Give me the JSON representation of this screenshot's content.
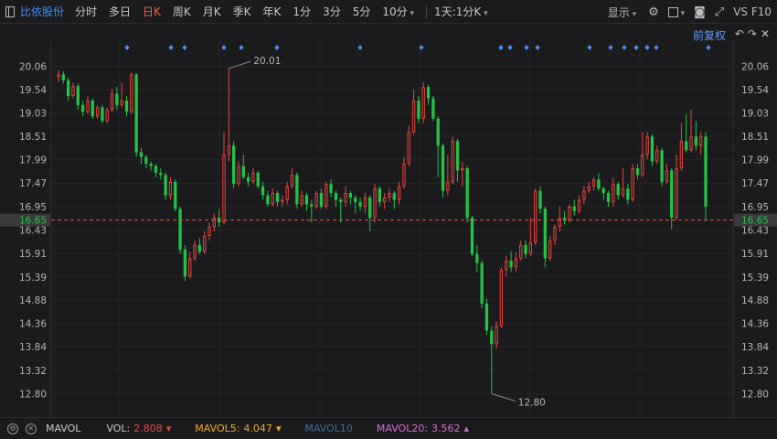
{
  "toolbar": {
    "stock_name": "比依股份",
    "periods": [
      "分时",
      "多日",
      "日K",
      "周K",
      "月K",
      "季K",
      "年K",
      "1分",
      "3分",
      "5分",
      "10分"
    ],
    "active_period": "日K",
    "combo": "1天:1分K",
    "display": "显示",
    "right_text": "VS F10"
  },
  "fuquan": "前复权",
  "icons": {
    "settings": "gear-icon",
    "window": "window-icon",
    "camera": "camera-icon",
    "expand": "expand-icon",
    "undo": "undo-icon",
    "redo": "redo-icon",
    "close": "close-icon"
  },
  "chart_data": {
    "type": "candlestick",
    "y_ticks": [
      "20.06",
      "19.54",
      "19.03",
      "18.51",
      "17.99",
      "17.47",
      "16.95",
      "16.43",
      "15.91",
      "15.39",
      "14.88",
      "14.36",
      "13.84",
      "13.32",
      "12.80"
    ],
    "ylim": [
      12.8,
      20.06
    ],
    "current_price": "16.65",
    "high_label": "20.01",
    "low_label": "12.80",
    "high": 20.01,
    "low": 12.8,
    "up_color": "#e8453c",
    "down_color": "#23c343",
    "candles": [
      [
        19.82,
        19.88,
        19.98,
        19.72
      ],
      [
        19.88,
        19.75,
        19.95,
        19.68
      ],
      [
        19.75,
        19.4,
        19.8,
        19.3
      ],
      [
        19.4,
        19.62,
        19.7,
        19.35
      ],
      [
        19.62,
        19.2,
        19.68,
        19.1
      ],
      [
        19.2,
        19.05,
        19.3,
        18.95
      ],
      [
        19.05,
        19.3,
        19.4,
        19.0
      ],
      [
        19.3,
        18.95,
        19.35,
        18.9
      ],
      [
        18.95,
        19.15,
        19.2,
        18.9
      ],
      [
        19.15,
        18.85,
        19.2,
        18.8
      ],
      [
        18.85,
        19.1,
        19.15,
        18.8
      ],
      [
        19.1,
        19.45,
        19.55,
        19.05
      ],
      [
        19.45,
        19.2,
        19.6,
        19.1
      ],
      [
        19.2,
        19.3,
        19.7,
        19.15
      ],
      [
        19.3,
        19.05,
        19.4,
        18.95
      ],
      [
        19.05,
        19.88,
        19.92,
        19.0
      ],
      [
        19.88,
        18.15,
        19.9,
        18.05
      ],
      [
        18.15,
        18.05,
        18.25,
        17.9
      ],
      [
        18.05,
        17.9,
        18.1,
        17.8
      ],
      [
        17.9,
        17.85,
        17.95,
        17.75
      ],
      [
        17.85,
        17.7,
        17.9,
        17.6
      ],
      [
        17.7,
        17.65,
        17.8,
        17.55
      ],
      [
        17.65,
        17.2,
        17.7,
        17.1
      ],
      [
        17.2,
        17.5,
        17.6,
        17.1
      ],
      [
        17.5,
        16.9,
        17.55,
        16.85
      ],
      [
        16.9,
        16.0,
        16.95,
        15.9
      ],
      [
        16.0,
        15.4,
        16.1,
        15.3
      ],
      [
        15.4,
        15.8,
        15.95,
        15.35
      ],
      [
        15.8,
        16.1,
        16.2,
        15.75
      ],
      [
        16.1,
        15.95,
        16.25,
        15.9
      ],
      [
        15.95,
        16.3,
        16.4,
        15.9
      ],
      [
        16.3,
        16.5,
        16.6,
        16.2
      ],
      [
        16.5,
        16.7,
        16.8,
        16.4
      ],
      [
        16.7,
        16.6,
        16.9,
        16.5
      ],
      [
        16.6,
        18.1,
        18.6,
        16.55
      ],
      [
        18.1,
        18.3,
        20.01,
        17.95
      ],
      [
        18.3,
        17.45,
        18.4,
        17.35
      ],
      [
        17.45,
        17.85,
        17.95,
        17.4
      ],
      [
        17.85,
        17.6,
        18.1,
        17.55
      ],
      [
        17.6,
        17.5,
        17.7,
        17.4
      ],
      [
        17.5,
        17.7,
        17.8,
        17.45
      ],
      [
        17.7,
        17.4,
        17.75,
        17.35
      ],
      [
        17.4,
        17.2,
        17.5,
        17.1
      ],
      [
        17.2,
        17.0,
        17.3,
        16.95
      ],
      [
        17.0,
        17.25,
        17.35,
        16.95
      ],
      [
        17.25,
        17.05,
        17.3,
        16.95
      ],
      [
        17.05,
        17.1,
        17.2,
        16.95
      ],
      [
        17.1,
        17.4,
        17.5,
        17.0
      ],
      [
        17.4,
        17.65,
        17.8,
        17.35
      ],
      [
        17.65,
        17.0,
        17.7,
        16.9
      ],
      [
        17.0,
        17.2,
        17.3,
        16.95
      ],
      [
        17.2,
        17.0,
        17.25,
        16.85
      ],
      [
        17.0,
        16.95,
        17.1,
        16.6
      ],
      [
        16.95,
        17.25,
        17.3,
        16.9
      ],
      [
        17.25,
        16.95,
        17.35,
        16.9
      ],
      [
        16.95,
        17.45,
        17.5,
        16.9
      ],
      [
        17.45,
        17.25,
        17.55,
        17.15
      ],
      [
        17.25,
        17.1,
        17.3,
        16.95
      ],
      [
        17.1,
        17.05,
        17.15,
        16.6
      ],
      [
        17.05,
        17.25,
        17.4,
        16.95
      ],
      [
        17.25,
        17.15,
        17.3,
        17.0
      ],
      [
        17.15,
        17.05,
        17.2,
        16.8
      ],
      [
        17.05,
        16.95,
        17.15,
        16.85
      ],
      [
        16.95,
        17.15,
        17.25,
        16.8
      ],
      [
        17.15,
        16.7,
        17.2,
        16.4
      ],
      [
        16.7,
        17.35,
        17.45,
        16.6
      ],
      [
        17.35,
        17.05,
        17.4,
        16.95
      ],
      [
        17.05,
        17.15,
        17.25,
        16.9
      ],
      [
        17.15,
        17.25,
        17.35,
        17.05
      ],
      [
        17.25,
        17.1,
        17.3,
        16.9
      ],
      [
        17.1,
        17.4,
        17.5,
        17.0
      ],
      [
        17.4,
        17.9,
        18.05,
        17.35
      ],
      [
        17.9,
        18.6,
        18.75,
        17.85
      ],
      [
        18.6,
        19.3,
        19.55,
        18.55
      ],
      [
        19.3,
        18.9,
        19.4,
        18.8
      ],
      [
        18.9,
        19.6,
        19.7,
        18.8
      ],
      [
        19.6,
        19.35,
        19.65,
        19.2
      ],
      [
        19.35,
        18.9,
        19.4,
        18.85
      ],
      [
        18.9,
        18.3,
        18.95,
        17.6
      ],
      [
        18.3,
        17.3,
        18.35,
        17.15
      ],
      [
        17.3,
        17.5,
        18.1,
        17.2
      ],
      [
        17.5,
        18.4,
        18.5,
        17.45
      ],
      [
        18.4,
        17.75,
        18.45,
        17.5
      ],
      [
        17.75,
        17.8,
        17.95,
        17.4
      ],
      [
        17.8,
        16.7,
        17.85,
        16.6
      ],
      [
        16.7,
        15.9,
        16.75,
        15.85
      ],
      [
        15.9,
        15.7,
        16.1,
        15.5
      ],
      [
        15.7,
        14.8,
        15.75,
        14.7
      ],
      [
        14.8,
        14.2,
        14.9,
        14.1
      ],
      [
        14.2,
        13.9,
        14.3,
        12.8
      ],
      [
        13.9,
        14.3,
        14.4,
        13.8
      ],
      [
        14.3,
        15.55,
        15.6,
        14.25
      ],
      [
        15.55,
        15.75,
        15.85,
        15.4
      ],
      [
        15.75,
        15.6,
        15.95,
        15.5
      ],
      [
        15.6,
        15.8,
        15.95,
        15.5
      ],
      [
        15.8,
        16.1,
        16.2,
        15.75
      ],
      [
        16.1,
        15.9,
        16.2,
        15.8
      ],
      [
        15.9,
        16.15,
        16.7,
        15.85
      ],
      [
        16.15,
        17.3,
        17.35,
        16.1
      ],
      [
        17.3,
        16.9,
        17.4,
        16.8
      ],
      [
        16.9,
        15.8,
        16.95,
        15.6
      ],
      [
        15.8,
        16.2,
        16.3,
        15.75
      ],
      [
        16.2,
        16.5,
        16.55,
        16.1
      ],
      [
        16.5,
        16.7,
        16.95,
        16.4
      ],
      [
        16.7,
        16.65,
        16.85,
        16.55
      ],
      [
        16.65,
        16.95,
        17.0,
        16.6
      ],
      [
        16.95,
        16.85,
        17.1,
        16.75
      ],
      [
        16.85,
        17.1,
        17.2,
        16.8
      ],
      [
        17.1,
        17.3,
        17.4,
        17.0
      ],
      [
        17.3,
        17.4,
        17.5,
        17.25
      ],
      [
        17.4,
        17.55,
        17.6,
        17.3
      ],
      [
        17.55,
        17.35,
        17.7,
        17.3
      ],
      [
        17.35,
        17.25,
        17.4,
        17.1
      ],
      [
        17.25,
        17.05,
        17.3,
        16.95
      ],
      [
        17.05,
        17.45,
        17.6,
        16.95
      ],
      [
        17.45,
        17.2,
        17.5,
        17.1
      ],
      [
        17.2,
        17.35,
        17.8,
        17.15
      ],
      [
        17.35,
        17.1,
        17.45,
        17.0
      ],
      [
        17.1,
        17.8,
        17.9,
        17.05
      ],
      [
        17.8,
        17.65,
        17.9,
        17.55
      ],
      [
        17.65,
        18.1,
        18.6,
        17.6
      ],
      [
        18.1,
        18.5,
        18.6,
        18.0
      ],
      [
        18.5,
        17.95,
        18.55,
        17.85
      ],
      [
        17.95,
        18.2,
        18.3,
        17.9
      ],
      [
        18.2,
        17.5,
        18.25,
        17.4
      ],
      [
        17.5,
        17.75,
        17.9,
        17.45
      ],
      [
        17.75,
        16.7,
        17.8,
        16.45
      ],
      [
        16.7,
        17.8,
        18.1,
        16.65
      ],
      [
        17.8,
        18.4,
        18.8,
        17.75
      ],
      [
        18.4,
        18.2,
        19.0,
        18.15
      ],
      [
        18.2,
        18.5,
        19.1,
        18.15
      ],
      [
        18.5,
        18.3,
        18.85,
        18.2
      ],
      [
        18.3,
        18.5,
        18.6,
        18.1
      ],
      [
        18.5,
        16.95,
        18.6,
        16.65
      ]
    ]
  },
  "bottom": {
    "indicator": "MAVOL",
    "vol_label": "VOL:",
    "vol_value": "2.808",
    "vol_dir": "▾",
    "vol_color": "#e8453c",
    "ma5_label": "MAVOL5:",
    "ma5_value": "4.047",
    "ma5_dir": "▾",
    "ma5_color": "#f5a623",
    "ma10_label": "MAVOL10",
    "ma10_color": "#3d6ea0",
    "ma20_label": "MAVOL20:",
    "ma20_value": "3.562",
    "ma20_dir": "▴",
    "ma20_color": "#d86bd8"
  }
}
